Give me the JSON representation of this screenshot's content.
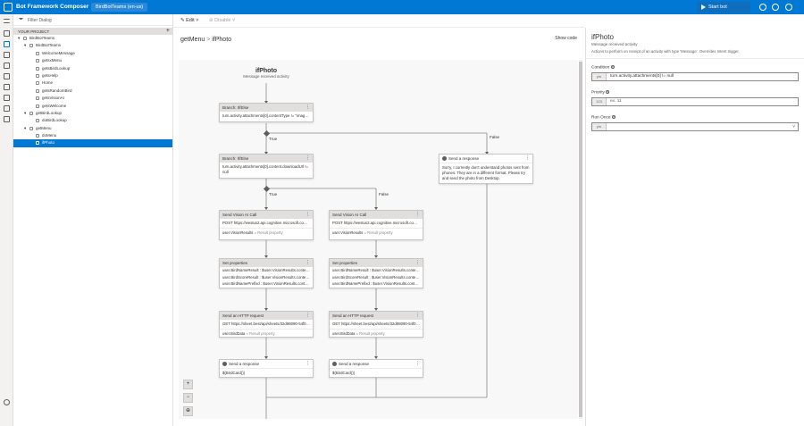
{
  "header": {
    "app_title": "Bot Framework Composer",
    "bot_chip": "BirdBotTeams (en-us)",
    "start_label": "Start bot"
  },
  "sidebar": {
    "filter_placeholder": "Filter Dialog",
    "project_label": "YOUR PROJECT",
    "items": [
      {
        "label": "BirdBotTeams",
        "level": 0,
        "caret": "▾"
      },
      {
        "label": "BirdBotTeams",
        "level": 1,
        "caret": "▾"
      },
      {
        "label": "WelcomeMessage",
        "level": 2,
        "caret": ""
      },
      {
        "label": "getsxMenu",
        "level": 2,
        "caret": ""
      },
      {
        "label": "getsBirdLookup",
        "level": 2,
        "caret": ""
      },
      {
        "label": "getsHelp",
        "level": 2,
        "caret": ""
      },
      {
        "label": "Home",
        "level": 2,
        "caret": ""
      },
      {
        "label": "getsRandomBird",
        "level": 2,
        "caret": ""
      },
      {
        "label": "getsVisionAI",
        "level": 2,
        "caret": ""
      },
      {
        "label": "getsWelcome",
        "level": 2,
        "caret": ""
      },
      {
        "label": "getBirdLookup",
        "level": 1,
        "caret": "▾"
      },
      {
        "label": "doBirdLookup",
        "level": 2,
        "caret": ""
      },
      {
        "label": "getMenu",
        "level": 1,
        "caret": "▾"
      },
      {
        "label": "doMenu",
        "level": 2,
        "caret": ""
      },
      {
        "label": "ifPhoto",
        "level": 2,
        "caret": "",
        "selected": true
      }
    ]
  },
  "toolbar": {
    "edit": "Edit",
    "disable": "Disable"
  },
  "canvas_head": {
    "crumb1": "getMenu",
    "crumb_sep": ">",
    "crumb2": "ifPhoto",
    "show_code": "Show code"
  },
  "flow": {
    "trigger_title": "ifPhoto",
    "trigger_sub": "Message received activity",
    "branch1_title": "Branch: If/Else",
    "branch1_cond": "turn.activity.attachments[0].contentType != \"image/*\"",
    "branch2_title": "Branch: If/Else",
    "branch2_cond": "turn.activity.attachments[0].content.downloadUrl != null",
    "true_label": "True",
    "false_label": "False",
    "true_label2": "True",
    "false_label2": "False",
    "resp_title": "Send a response",
    "resp_text": "Sorry, I currently don't understand photos sent from phones. They are in a different format. Please try and send the photo from Desktop.",
    "left": {
      "vision_title": "Send Vision AI Call",
      "vision_req": "POST https://westus2.api.cognitive.microsoft.com/c...",
      "vision_result": "user.VisionResults",
      "set_title": "Set properties",
      "set1": "user.BirdNameResult : $user.VisionResults.content.p...",
      "set2": "user.BirdScoreResult : $user.VisionResults.content.p...",
      "set3": "user.BirdNamePrefixd : $user.VisionResults.content...",
      "http_title": "Send an HTTP request",
      "http_req": "GET https://sheet.best/api/sheets/32d98090-54f0-47...",
      "http_result": "user.BirdData",
      "resp_title": "Send a response",
      "resp_text": "${BirdCard()}"
    },
    "right": {
      "vision_title": "Send Vision AI Call",
      "vision_req": "POST https://westus2.api.cognitive.microsoft.com/c...",
      "vision_result": "user.VisionResults",
      "set_title": "Set properties",
      "set1": "user.BirdNameResult : $user.VisionResults.content.p...",
      "set2": "user.BirdScoreResult : $user.VisionResults.content.p...",
      "set3": "user.BirdNamePrefixd : $user.VisionResults.content...",
      "http_title": "Send an HTTP request",
      "http_req": "GET https://sheet.best/api/sheets/32d98090-54f0-47...",
      "http_result": "user.BirdData",
      "resp_title": "Send a response",
      "resp_text": "${BirdCard()}"
    },
    "result_arrow": "=",
    "result_prop": "Result property",
    "more": "⋮"
  },
  "properties": {
    "title": "ifPhoto",
    "subtitle": "Message received activity",
    "description": "Actions to perform on receipt of an activity with type 'Message'. Overrides Intent trigger.",
    "condition_label": "Condition",
    "condition_tag": "y/n",
    "condition_value": "turn.activity.attachments[0] != null",
    "priority_label": "Priority",
    "priority_tag": "123",
    "priority_placeholder": "ex. 11",
    "runonce_label": "Run Once",
    "runonce_tag": "y/n",
    "runonce_value": ""
  },
  "colors": {
    "brand": "#0078d4",
    "node_header": "#e1dfdd"
  }
}
